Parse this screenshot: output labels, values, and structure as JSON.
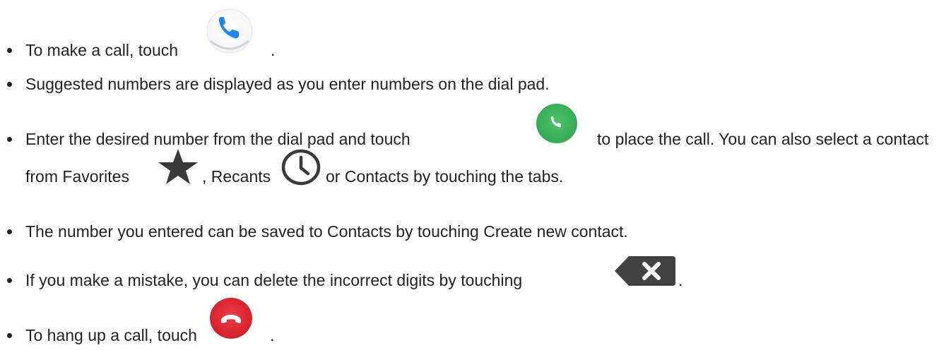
{
  "items": [
    {
      "text_before": "To make a call, touch",
      "icon": "phone-app-icon",
      "text_after": "."
    },
    {
      "text": "Suggested numbers are displayed as you enter numbers on the dial pad."
    },
    {
      "text_before": "Enter the desired number from the dial pad and touch",
      "icon": "green-call-button-icon",
      "text_after": "to place the call. You can also select a contact",
      "line2_text_1": "from Favorites",
      "line2_icon_1": "star-icon",
      "line2_text_2": ", Recants",
      "line2_icon_2": "clock-icon",
      "line2_text_3": "or Contacts by touching the tabs."
    },
    {
      "text": "The number you entered can be saved to Contacts by touching Create new contact."
    },
    {
      "text_before": "If you make a mistake, you can delete the incorrect digits by touching",
      "icon": "backspace-delete-icon",
      "text_after": "."
    },
    {
      "text_before": "To hang up a call, touch",
      "icon": "red-end-call-button-icon",
      "text_after": "."
    }
  ],
  "colors": {
    "text": "#222222",
    "phone_blue": "#1e88e5",
    "call_green": "#3fb55a",
    "end_red": "#e0232e",
    "icon_dark": "#3a3a3a"
  }
}
